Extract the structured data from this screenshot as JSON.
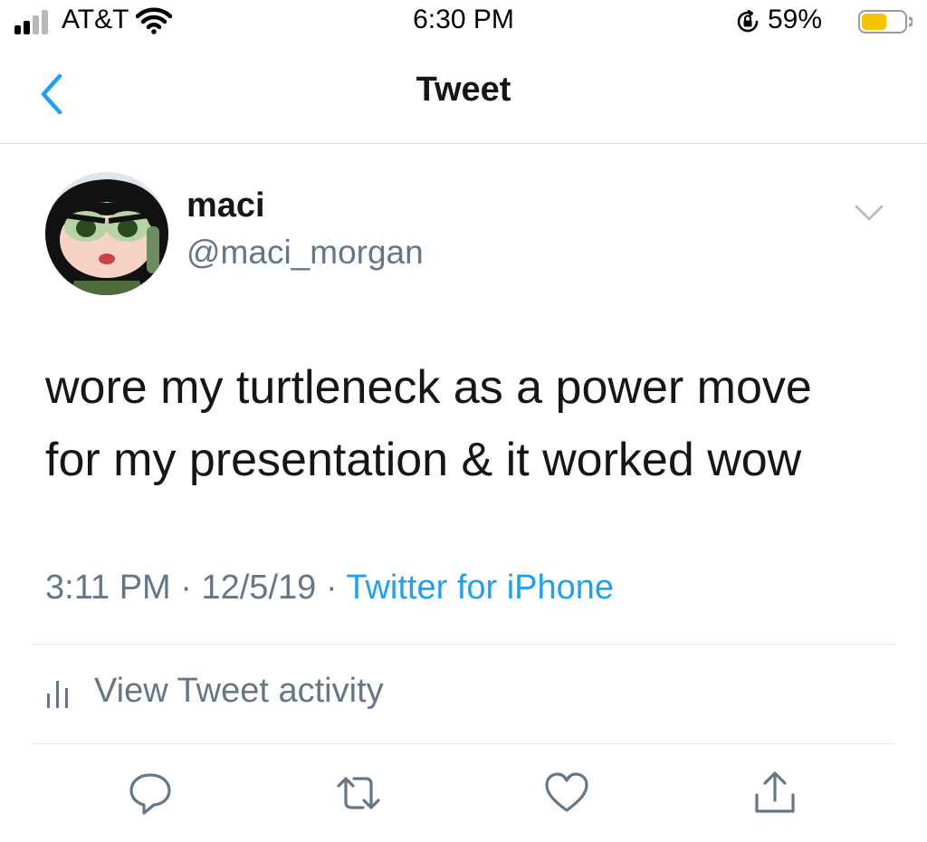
{
  "status_bar": {
    "carrier": "AT&T",
    "time": "6:30 PM",
    "battery_percent": "59%",
    "battery_level": 0.59,
    "battery_color": "#f5c400"
  },
  "nav": {
    "title": "Tweet"
  },
  "tweet": {
    "display_name": "maci",
    "handle": "@maci_morgan",
    "text_line1": "wore my turtleneck as a power move",
    "text_line2": "for my presentation & it worked wow",
    "time": "3:11 PM",
    "date": "12/5/19",
    "separator": "·",
    "source": "Twitter for iPhone"
  },
  "activity": {
    "label": "View Tweet activity"
  },
  "actions": {
    "icons": [
      "reply-icon",
      "retweet-icon",
      "like-icon",
      "share-icon"
    ]
  },
  "colors": {
    "accent": "#1da1f2",
    "secondary_text": "#657786",
    "primary_text": "#14171a",
    "divider": "#e1e8ed"
  }
}
